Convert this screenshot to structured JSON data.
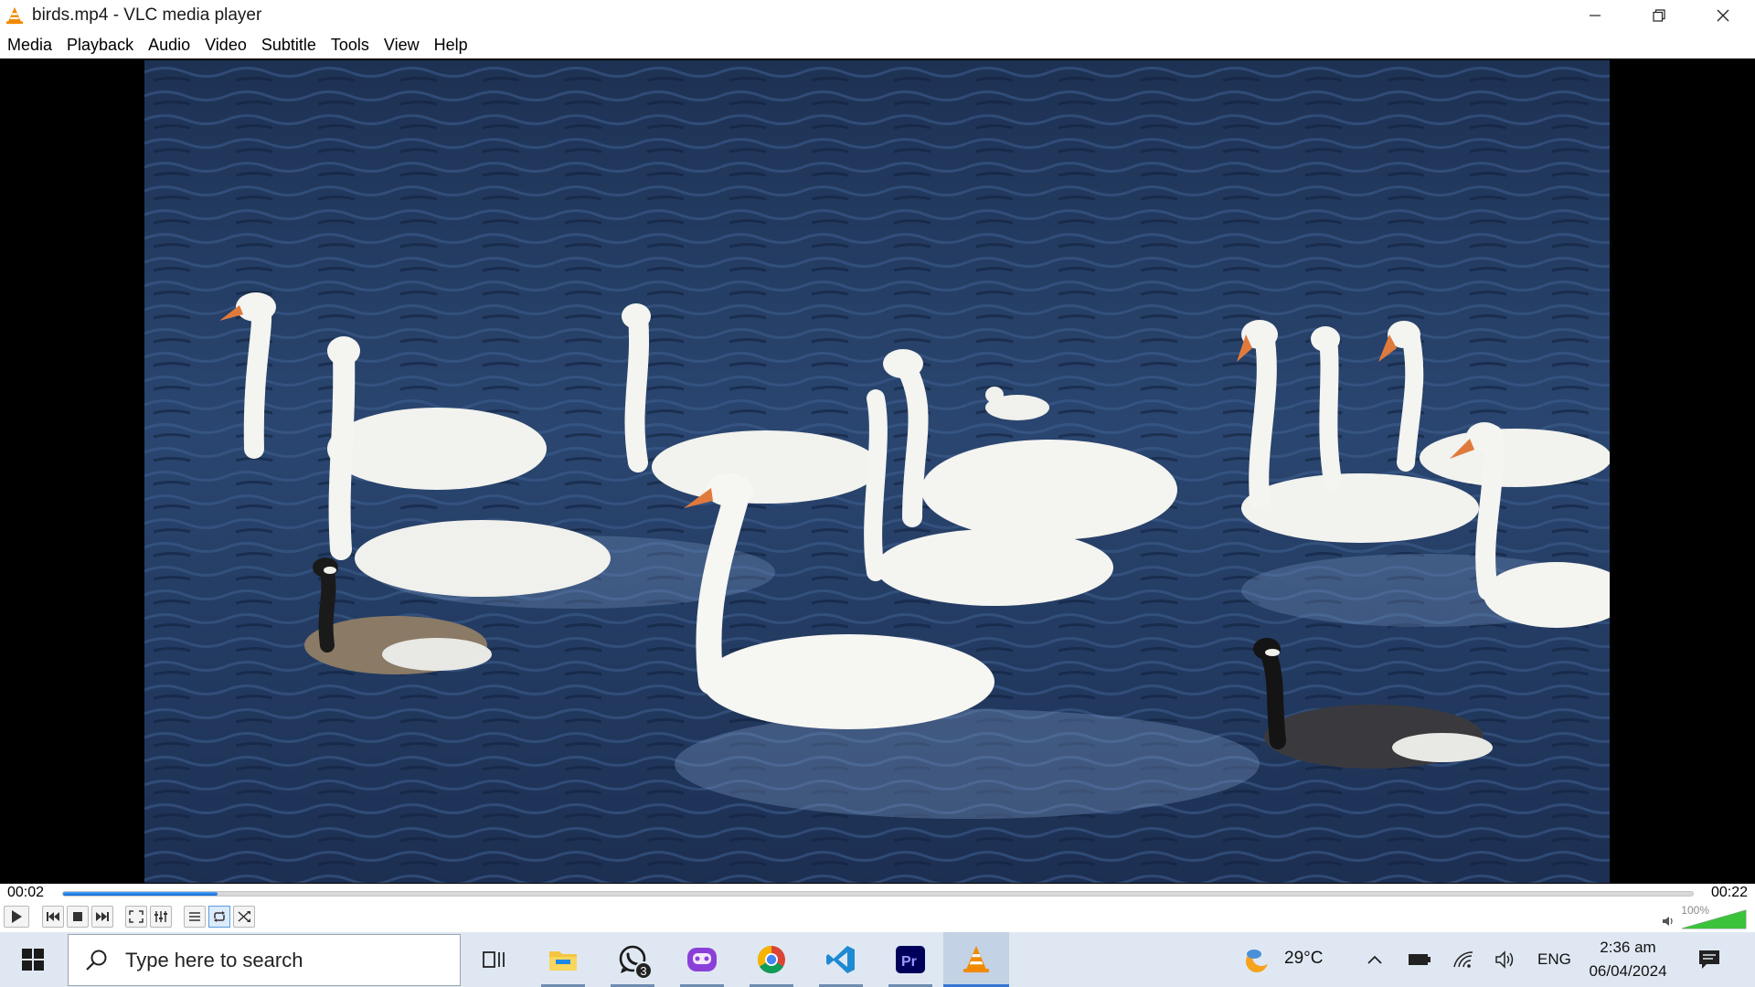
{
  "window": {
    "title": "birds.mp4 - VLC media player"
  },
  "menu": {
    "items": [
      "Media",
      "Playback",
      "Audio",
      "Video",
      "Subtitle",
      "Tools",
      "View",
      "Help"
    ]
  },
  "player": {
    "elapsed": "00:02",
    "total": "00:22",
    "progress_fraction": 0.095,
    "volume_label": "100%",
    "volume_fraction": 1.0,
    "loop_active": true
  },
  "taskbar": {
    "search_placeholder": "Type here to search",
    "whatsapp_badge": "3",
    "weather": "29°C",
    "language": "ENG",
    "time": "2:36 am",
    "date": "06/04/2024"
  },
  "colors": {
    "accent_blue": "#1068d0",
    "vlc_orange": "#f08a00",
    "taskbar_bg": "#dfe8f2"
  }
}
